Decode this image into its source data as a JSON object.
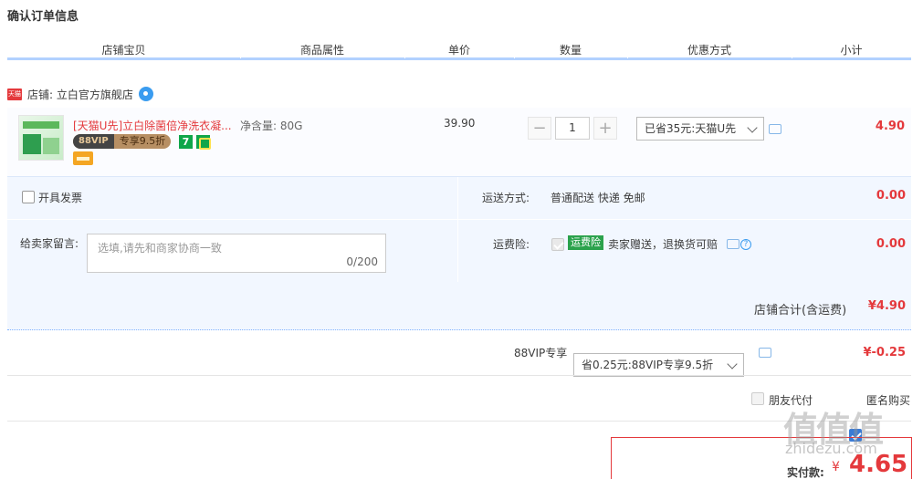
{
  "page_title": "确认订单信息",
  "columns": [
    "店铺宝贝",
    "商品属性",
    "单价",
    "数量",
    "优惠方式",
    "小计"
  ],
  "shop": {
    "badge": "天猫",
    "name": "店铺: 立白官方旗舰店"
  },
  "item": {
    "name": "[天猫U先]立白除菌倍净洗衣凝...",
    "vip_prefix": "88VIP",
    "vip_discount": "专享9.5折",
    "seven_day_badge": "7",
    "attribute": "净含量: 80G",
    "price": "39.90",
    "quantity": "1",
    "qty_minus": "−",
    "qty_plus": "+",
    "promo": "已省35元:天猫U先",
    "subtotal": "4.90"
  },
  "invoice_label": "开具发票",
  "shipping": {
    "label": "运送方式:",
    "value": "普通配送 快递 免邮",
    "price": "0.00"
  },
  "message": {
    "label": "给卖家留言:",
    "placeholder": "选填,请先和商家协商一致",
    "counter": "0/200"
  },
  "insurance": {
    "label": "运费险:",
    "tag": "运费险",
    "desc": "卖家赠送，退换货可赔",
    "help": "?",
    "price": "0.00"
  },
  "shop_total": {
    "label": "店铺合计(含运费)",
    "value": "¥4.90"
  },
  "vip_row": {
    "label": "88VIP专享",
    "select": "省0.25元:88VIP专享9.5折",
    "value": "¥-0.25"
  },
  "options": {
    "friend_pay": "朋友代付",
    "anonymous": "匿名购买"
  },
  "pay": {
    "label": "实付款:",
    "currency": "¥",
    "value": "4.65"
  },
  "watermark": {
    "glyphs": "值值值",
    "site": "zhidezu.com"
  },
  "colors": {
    "accent_red": "#e4393c",
    "header_border": "#b2d1ff",
    "panel_bg": "#f2f7ff"
  }
}
